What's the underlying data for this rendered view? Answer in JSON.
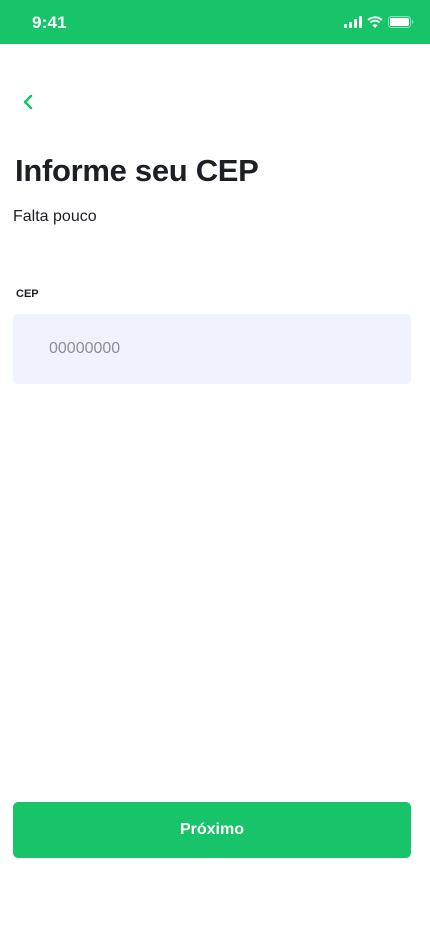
{
  "status_bar": {
    "time": "9:41",
    "icons": [
      "signal-icon",
      "wifi-icon",
      "battery-icon"
    ]
  },
  "header": {
    "back_icon": "chevron-left-icon"
  },
  "main": {
    "title": "Informe seu CEP",
    "subtitle": "Falta pouco",
    "cep_field": {
      "label": "CEP",
      "value": "",
      "placeholder": "00000000"
    },
    "next_button_label": "Próximo"
  },
  "colors": {
    "brand_green": "#17c46a",
    "input_background": "#eff3fd",
    "text_primary": "#1c1f24",
    "placeholder": "#8b8f97"
  }
}
